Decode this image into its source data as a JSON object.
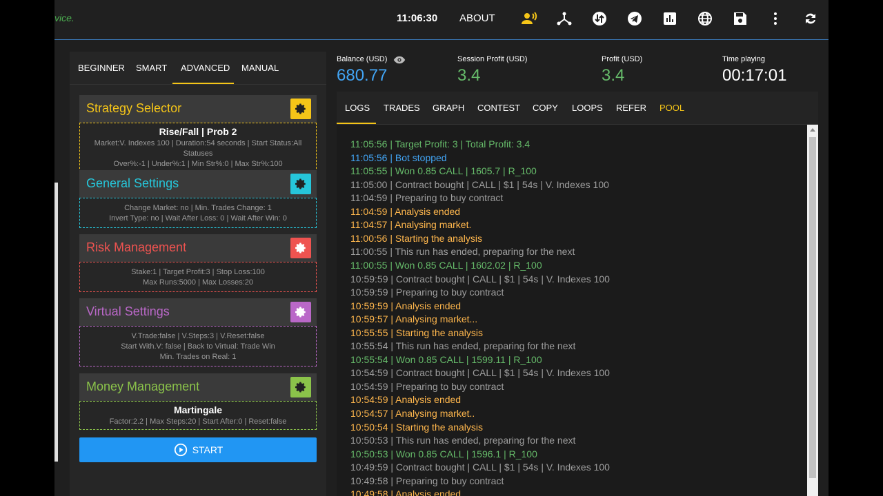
{
  "topbar": {
    "brand_tail": "vice.",
    "clock": "11:06:30",
    "about": "ABOUT",
    "icons": [
      "voice-user-icon",
      "hierarchy-icon",
      "transfer-icon",
      "telegram-icon",
      "chart-icon",
      "globe-icon",
      "save-icon",
      "more-vert-icon",
      "sync-icon"
    ]
  },
  "mode_tabs": [
    "BEGINNER",
    "SMART",
    "ADVANCED",
    "MANUAL"
  ],
  "active_mode": "ADVANCED",
  "cards": {
    "strategy": {
      "title": "Strategy Selector",
      "color": "#f5c518",
      "main": "Rise/Fall | Prob 2",
      "line1": "Market:V. Indexes 100 | Duration:54 seconds | Start Status:All Statuses",
      "line2": "Over%:-1 | Under%:1 | Min Str%:0 | Max Str%:100"
    },
    "general": {
      "title": "General Settings",
      "color": "#26c6da",
      "line1": "Change Market: no | Min. Trades Change: 1",
      "line2": "Invert Type: no | Wait After Loss: 0 | Wait After Win: 0"
    },
    "risk": {
      "title": "Risk Management",
      "color": "#ef5350",
      "line1": "Stake:1 | Target Profit:3 | Stop Loss:100",
      "line2": "Max Runs:5000 | Max Losses:20"
    },
    "virtual": {
      "title": "Virtual Settings",
      "color": "#ba68c8",
      "line1": "V.Trade:false | V.Steps:3 | V.Reset:false",
      "line2": "Start With.V: false | Back to Virtual: Trade Win",
      "line3": "Min. Trades on Real: 1"
    },
    "money": {
      "title": "Money Management",
      "color": "#8bc34a",
      "main": "Martingale",
      "line1": "Factor:2.2 | Max Steps:20 | Start After:0 | Reset:false"
    }
  },
  "start_label": "START",
  "stats": {
    "balance_label": "Balance (USD)",
    "balance": "680.77",
    "session_label": "Session Profit (USD)",
    "session": "3.4",
    "profit_label": "Profit (USD)",
    "profit": "3.4",
    "time_label": "Time playing",
    "time": "00:17:01"
  },
  "log_tabs": [
    "LOGS",
    "TRADES",
    "GRAPH",
    "CONTEST",
    "COPY",
    "LOOPS",
    "REFER",
    "POOL"
  ],
  "logs": [
    {
      "text": "11:05:56 | Target Profit: 3 | Total Profit: 3.4",
      "color": "#66bb6a"
    },
    {
      "text": "11:05:56 | Bot stopped",
      "color": "#42a5f5"
    },
    {
      "text": "11:05:55 | Won 0.85 CALL | 1605.7 | R_100",
      "color": "#66bb6a"
    },
    {
      "text": "11:05:00 | Contract bought | CALL | $1 | 54s | V. Indexes 100",
      "color": "#9e9e9e"
    },
    {
      "text": "11:04:59 | Preparing to buy contract",
      "color": "#9e9e9e"
    },
    {
      "text": "11:04:59 | Analysis ended",
      "color": "#ffb74d"
    },
    {
      "text": "11:04:57 | Analysing market.",
      "color": "#ffb74d"
    },
    {
      "text": "11:00:56 | Starting the analysis",
      "color": "#ffb74d"
    },
    {
      "text": "11:00:55 | This run has ended, preparing for the next",
      "color": "#9e9e9e"
    },
    {
      "text": "11:00:55 | Won 0.85 CALL | 1602.02 | R_100",
      "color": "#66bb6a"
    },
    {
      "text": "10:59:59 | Contract bought | CALL | $1 | 54s | V. Indexes 100",
      "color": "#9e9e9e"
    },
    {
      "text": "10:59:59 | Preparing to buy contract",
      "color": "#9e9e9e"
    },
    {
      "text": "10:59:59 | Analysis ended",
      "color": "#ffb74d"
    },
    {
      "text": "10:59:57 | Analysing market...",
      "color": "#ffb74d"
    },
    {
      "text": "10:55:55 | Starting the analysis",
      "color": "#ffb74d"
    },
    {
      "text": "10:55:54 | This run has ended, preparing for the next",
      "color": "#9e9e9e"
    },
    {
      "text": "10:55:54 | Won 0.85 CALL | 1599.11 | R_100",
      "color": "#66bb6a"
    },
    {
      "text": "10:54:59 | Contract bought | CALL | $1 | 54s | V. Indexes 100",
      "color": "#9e9e9e"
    },
    {
      "text": "10:54:59 | Preparing to buy contract",
      "color": "#9e9e9e"
    },
    {
      "text": "10:54:59 | Analysis ended",
      "color": "#ffb74d"
    },
    {
      "text": "10:54:57 | Analysing market..",
      "color": "#ffb74d"
    },
    {
      "text": "10:50:54 | Starting the analysis",
      "color": "#ffb74d"
    },
    {
      "text": "10:50:53 | This run has ended, preparing for the next",
      "color": "#9e9e9e"
    },
    {
      "text": "10:50:53 | Won 0.85 CALL | 1596.1 | R_100",
      "color": "#66bb6a"
    },
    {
      "text": "10:49:59 | Contract bought | CALL | $1 | 54s | V. Indexes 100",
      "color": "#9e9e9e"
    },
    {
      "text": "10:49:58 | Preparing to buy contract",
      "color": "#9e9e9e"
    },
    {
      "text": "10:49:58 | Analysis ended",
      "color": "#ffb74d"
    }
  ]
}
